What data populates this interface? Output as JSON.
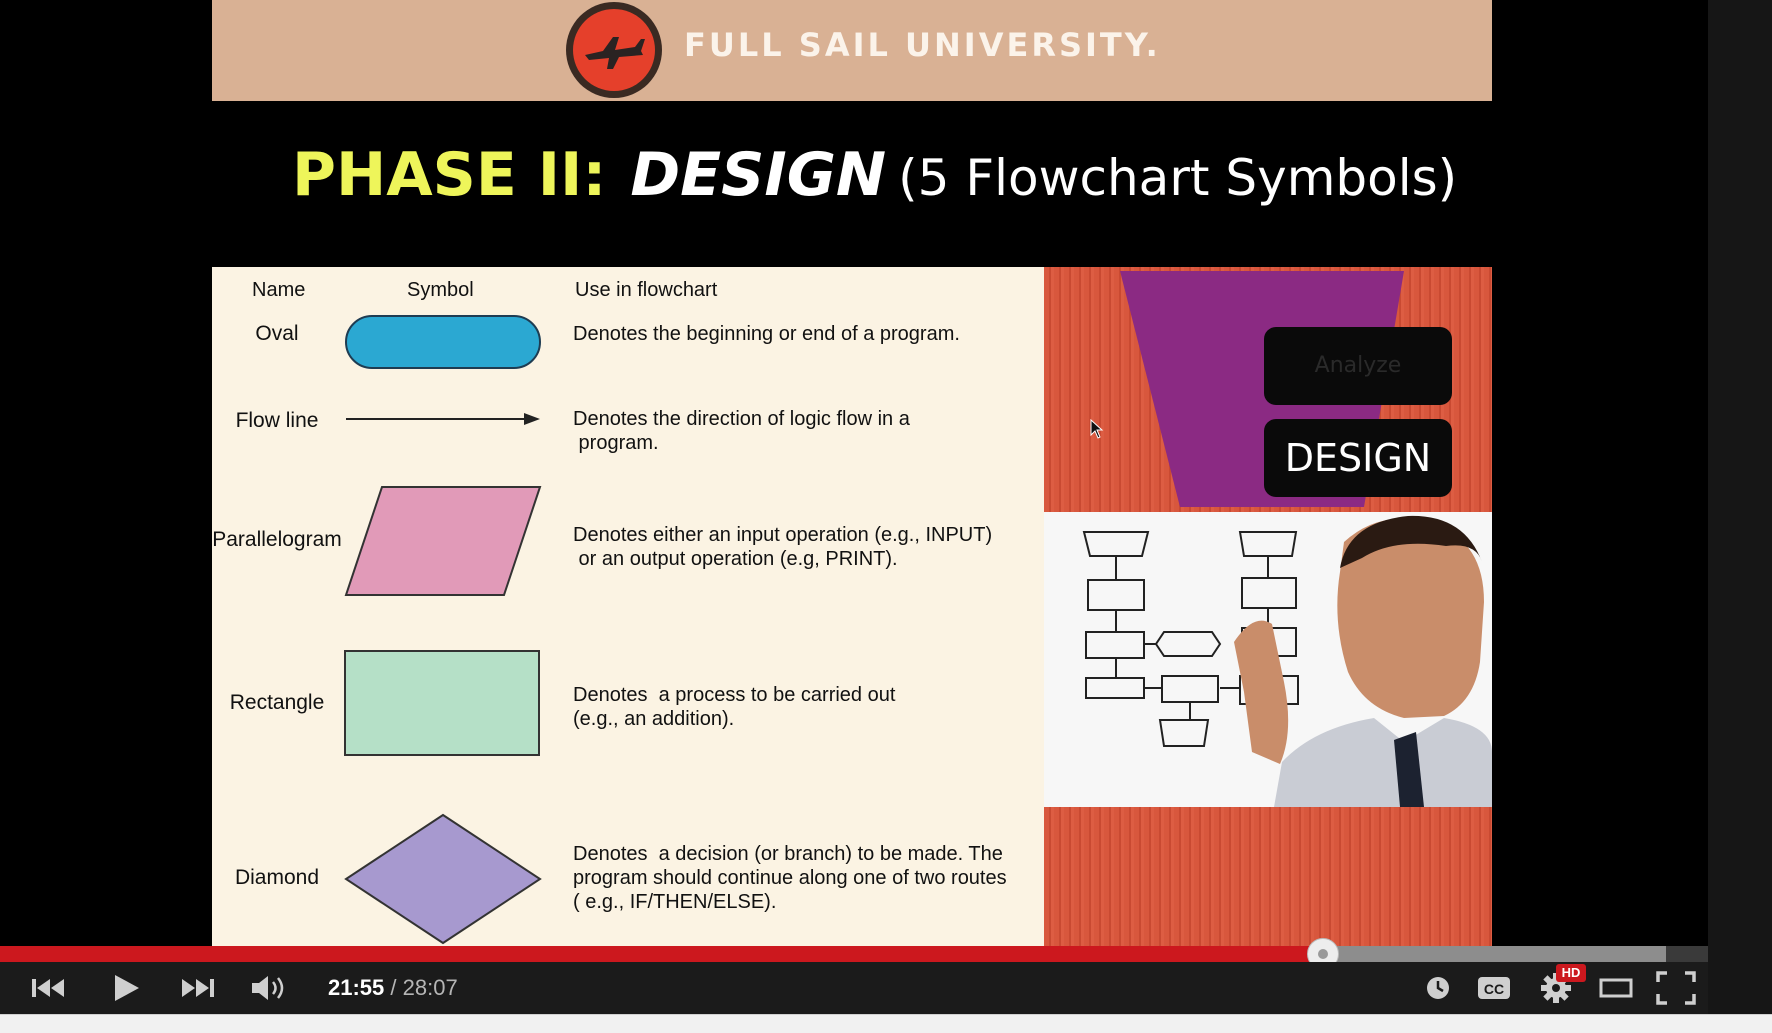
{
  "slide": {
    "banner_text": "FULL SAIL UNIVERSITY.",
    "title_phase": "PHASE II:",
    "title_design": "DESIGN",
    "title_sub": "(5 Flowchart Symbols)",
    "table": {
      "headers": [
        "Name",
        "Symbol",
        "Use in flowchart"
      ],
      "rows": [
        {
          "name": "Oval",
          "symbol": "oval-icon",
          "desc_lines": [
            "Denotes the beginning or end of a program."
          ]
        },
        {
          "name": "Flow line",
          "symbol": "arrow-icon",
          "desc_lines": [
            "Denotes the direction of logic flow in a",
            " program."
          ]
        },
        {
          "name": "Parallelogram",
          "symbol": "parallelogram-icon",
          "desc_lines": [
            "Denotes either an input operation (e.g., INPUT)",
            " or an output operation (e.g, PRINT)."
          ]
        },
        {
          "name": "Rectangle",
          "symbol": "rectangle-icon",
          "desc_lines": [
            "Denotes  a process to be carried out",
            "(e.g., an addition)."
          ]
        },
        {
          "name": "Diamond",
          "symbol": "diamond-icon",
          "desc_lines": [
            "Denotes  a decision (or branch) to be made. The",
            "program should continue along one of two routes",
            "( e.g., IF/THEN/ELSE)."
          ]
        }
      ]
    },
    "side_boxes": {
      "analyze": "Analyze",
      "design": "DESIGN"
    },
    "colors": {
      "oval": "#2ba8d2",
      "parallelogram": "#e19ab8",
      "rectangle": "#b5e0c7",
      "diamond": "#a799cf",
      "banner": "#d9b194",
      "accent": "#cc181e"
    }
  },
  "player": {
    "time_current": "21:55",
    "time_total": "/ 28:07",
    "progress_fraction": 0.7743,
    "buffered_fraction": 0.9753,
    "hd_label": "HD",
    "controls": [
      "previous-icon",
      "play-icon",
      "next-icon",
      "volume-icon",
      "watch-later-icon",
      "captions-icon",
      "settings-icon",
      "theater-mode-icon",
      "fullscreen-icon"
    ]
  }
}
